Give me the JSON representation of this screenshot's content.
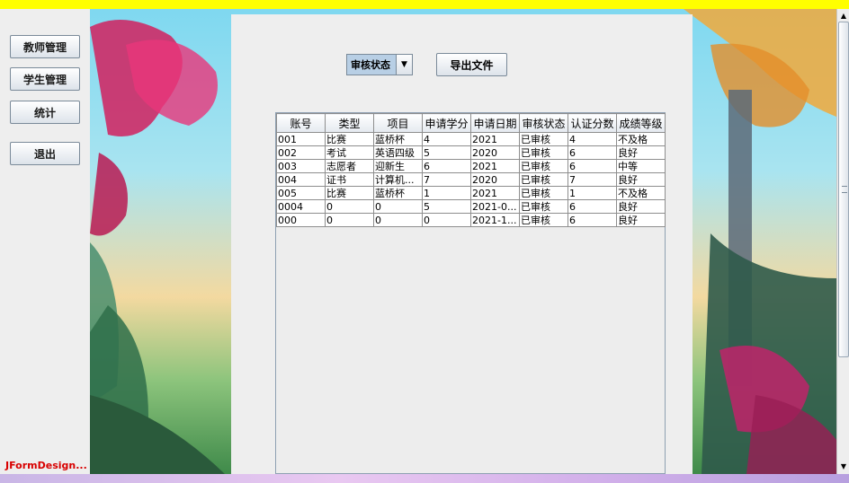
{
  "sidebar": {
    "buttons": [
      "教师管理",
      "学生管理",
      "统计",
      "退出"
    ],
    "brand": "JFormDesign..."
  },
  "toolbar": {
    "status_combo": "审核状态",
    "export_label": "导出文件"
  },
  "table": {
    "headers": [
      "账号",
      "类型",
      "项目",
      "申请学分",
      "申请日期",
      "审核状态",
      "认证分数",
      "成绩等级"
    ],
    "rows": [
      [
        "001",
        "比赛",
        "蓝桥杯",
        "4",
        "2021",
        "已审核",
        "4",
        "不及格"
      ],
      [
        "002",
        "考试",
        "英语四级",
        "5",
        "2020",
        "已审核",
        "6",
        "良好"
      ],
      [
        "003",
        "志愿者",
        "迎新生",
        "6",
        "2021",
        "已审核",
        "6",
        "中等"
      ],
      [
        "004",
        "证书",
        "计算机...",
        "7",
        "2020",
        "已审核",
        "7",
        "良好"
      ],
      [
        "005",
        "比赛",
        "蓝桥杯",
        "1",
        "2021",
        "已审核",
        "1",
        "不及格"
      ],
      [
        "0004",
        "0",
        "0",
        "5",
        "2021-0...",
        "已审核",
        "6",
        "良好"
      ],
      [
        "000",
        "0",
        "0",
        "0",
        "2021-1...",
        "已审核",
        "6",
        "良好"
      ]
    ]
  },
  "colors": {
    "top_bar": "#ffff00",
    "brand_text": "#d80000",
    "button_border": "#7a8a99"
  }
}
